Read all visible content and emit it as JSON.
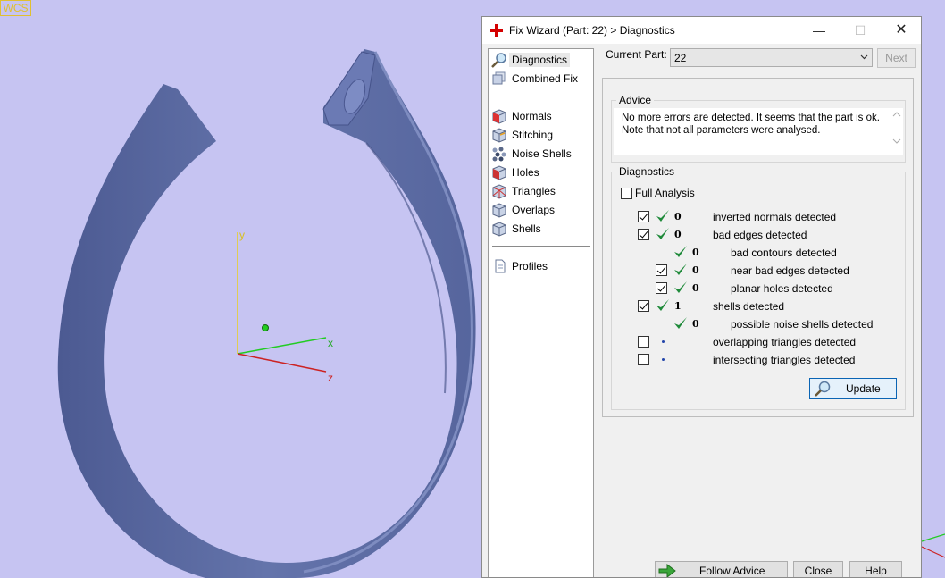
{
  "window": {
    "title": "Fix Wizard (Part: 22) > Diagnostics",
    "controls": {
      "minimize": "—",
      "maximize": "☐",
      "close": "✕"
    }
  },
  "viewport": {
    "axes": {
      "x": "x",
      "y": "y",
      "z": "z",
      "wcs": "WCS"
    },
    "colors": {
      "background": "#c6c4f2",
      "model": "#5b6aa0",
      "x_axis": "#22cc22",
      "y_axis": "#e8d020",
      "z_axis": "#cc2222"
    }
  },
  "nav": {
    "items": [
      {
        "label": "Diagnostics",
        "icon": "magnifier-icon",
        "selected": true
      },
      {
        "label": "Combined Fix",
        "icon": "combined-fix-icon"
      },
      {
        "label": "Normals",
        "icon": "normals-cube-icon"
      },
      {
        "label": "Stitching",
        "icon": "stitching-cube-icon"
      },
      {
        "label": "Noise Shells",
        "icon": "noise-shells-icon"
      },
      {
        "label": "Holes",
        "icon": "holes-cube-icon"
      },
      {
        "label": "Triangles",
        "icon": "triangles-cube-icon"
      },
      {
        "label": "Overlaps",
        "icon": "overlaps-cube-icon"
      },
      {
        "label": "Shells",
        "icon": "shells-cube-icon"
      },
      {
        "label": "Profiles",
        "icon": "profiles-page-icon"
      }
    ]
  },
  "header": {
    "current_part_label": "Current Part:",
    "current_part_value": "22",
    "next_label": "Next"
  },
  "advice": {
    "title": "Advice",
    "line1": "No more errors are detected. It seems that the part is ok.",
    "line2": "Note that not all parameters were analysed."
  },
  "diagnostics": {
    "title": "Diagnostics",
    "full_analysis_label": "Full Analysis",
    "rows": [
      {
        "checkbox": true,
        "checked": true,
        "status": "ok",
        "count": "0",
        "label": "inverted normals detected",
        "indent": 0
      },
      {
        "checkbox": true,
        "checked": true,
        "status": "ok",
        "count": "0",
        "label": "bad edges detected",
        "indent": 0
      },
      {
        "checkbox": false,
        "checked": false,
        "status": "ok",
        "count": "0",
        "label": "bad contours detected",
        "indent": 1
      },
      {
        "checkbox": true,
        "checked": true,
        "status": "ok",
        "count": "0",
        "label": "near bad edges detected",
        "indent": 1
      },
      {
        "checkbox": true,
        "checked": true,
        "status": "ok",
        "count": "0",
        "label": "planar holes detected",
        "indent": 1
      },
      {
        "checkbox": true,
        "checked": true,
        "status": "ok",
        "count": "1",
        "label": "shells detected",
        "indent": 0
      },
      {
        "checkbox": false,
        "checked": false,
        "status": "ok",
        "count": "0",
        "label": "possible noise shells detected",
        "indent": 1
      },
      {
        "checkbox": true,
        "checked": false,
        "status": "none",
        "count": "",
        "label": "overlapping triangles detected",
        "indent": 0
      },
      {
        "checkbox": true,
        "checked": false,
        "status": "none",
        "count": "",
        "label": "intersecting triangles detected",
        "indent": 0
      }
    ],
    "update_label": "Update"
  },
  "footer": {
    "follow_label": "Follow Advice",
    "close_label": "Close",
    "help_label": "Help"
  }
}
